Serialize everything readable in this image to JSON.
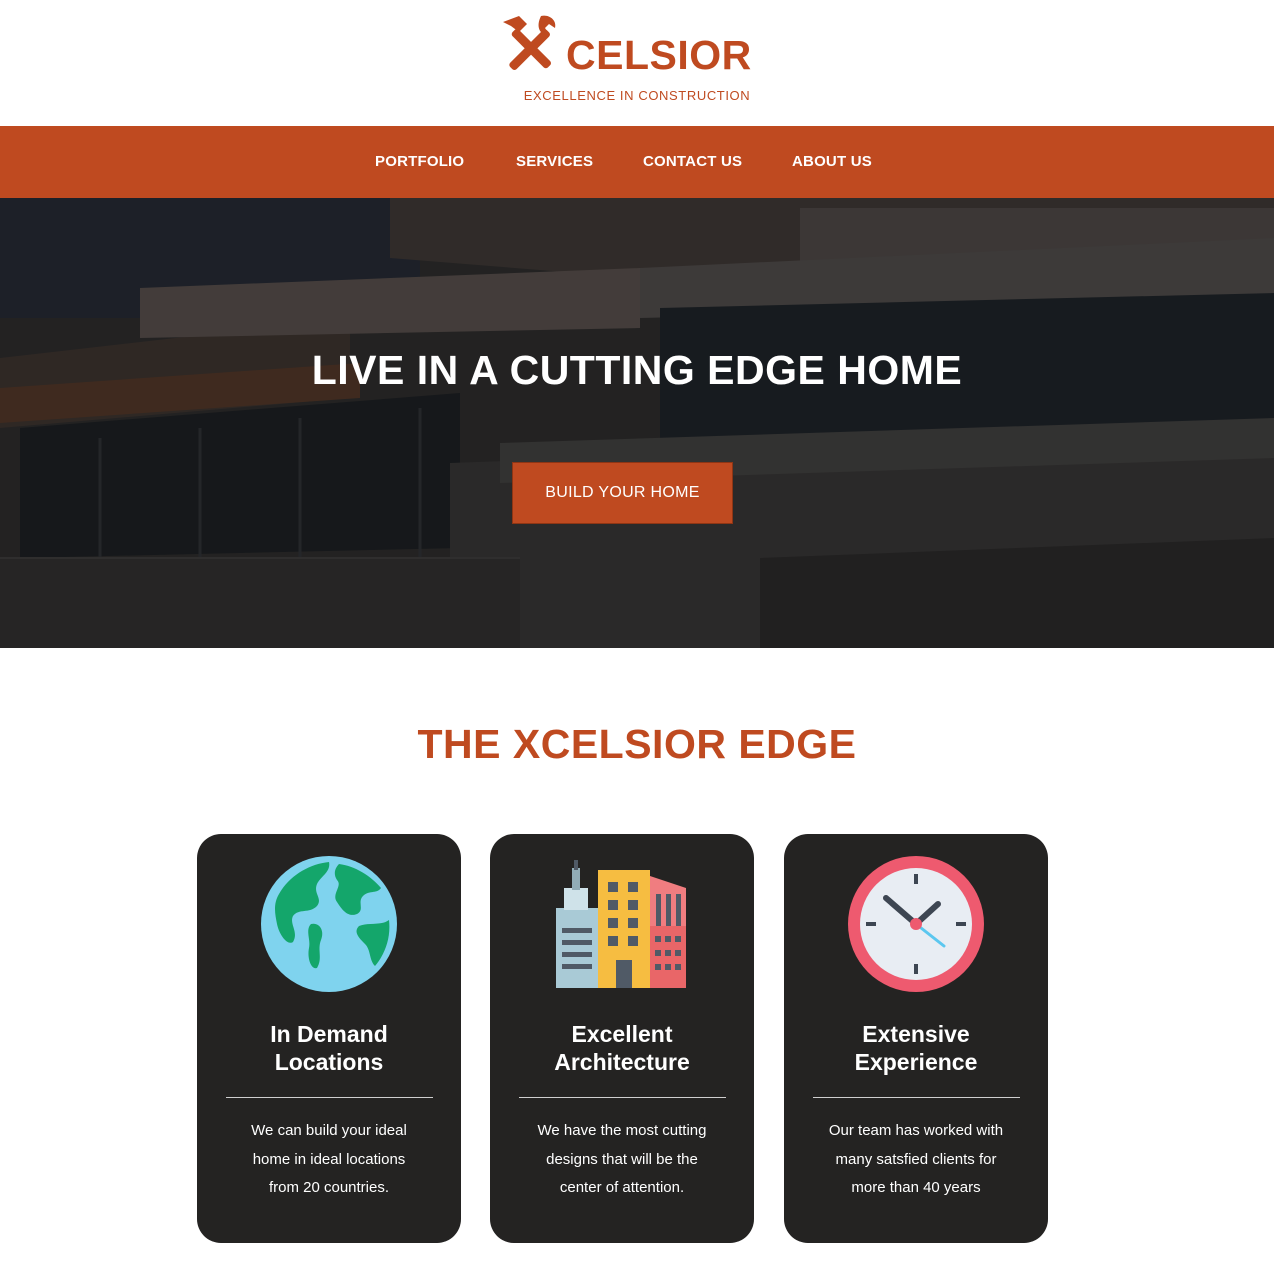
{
  "brand": {
    "name": "CELSIOR",
    "tagline": "EXCELLENCE IN CONSTRUCTION",
    "accent_color": "#bf4a20",
    "logo_icon": "hammer-wrench-icon"
  },
  "nav": {
    "items": [
      {
        "label": "PORTFOLIO"
      },
      {
        "label": "SERVICES"
      },
      {
        "label": "CONTACT US"
      },
      {
        "label": "ABOUT US"
      }
    ]
  },
  "hero": {
    "title": "LIVE IN A CUTTING EDGE HOME",
    "cta_label": "BUILD YOUR HOME",
    "background": "modern-house-photo"
  },
  "features": {
    "title": "THE XCELSIOR EDGE",
    "cards": [
      {
        "icon": "globe-icon",
        "title_line1": "In Demand",
        "title_line2": "Locations",
        "text_lines": [
          "We can build your ideal",
          "home in ideal locations",
          "from 20 countries."
        ]
      },
      {
        "icon": "buildings-icon",
        "title_line1": "Excellent",
        "title_line2": "Architecture",
        "text_lines": [
          "We have the most cutting",
          "designs that will be the",
          "center of attention."
        ]
      },
      {
        "icon": "clock-icon",
        "title_line1": "Extensive",
        "title_line2": "Experience",
        "text_lines": [
          "Our team has worked with",
          "many satsfied clients for",
          "more than 40 years"
        ]
      }
    ]
  }
}
